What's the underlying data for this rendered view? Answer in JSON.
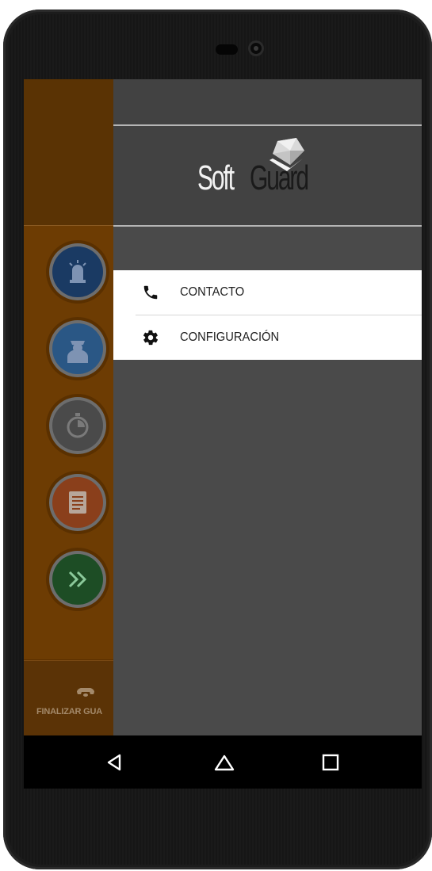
{
  "app": {
    "logo": {
      "part1": "Soft",
      "part2": "Guard"
    }
  },
  "drawer": {
    "menu": [
      {
        "label": "CONTACTO",
        "icon": "phone-icon"
      },
      {
        "label": "CONFIGURACIÓN",
        "icon": "gear-icon"
      }
    ]
  },
  "background": {
    "buttons": [
      {
        "icon": "siren-icon",
        "color": "#1a3a63"
      },
      {
        "icon": "guard-icon",
        "color": "#2a5785"
      },
      {
        "icon": "timer-icon",
        "color": "#4a4a4a"
      },
      {
        "icon": "document-icon",
        "color": "#8a3f1b"
      },
      {
        "icon": "forward-icon",
        "color": "#1d4d25"
      }
    ],
    "footer": {
      "label": "FINALIZAR GUA",
      "icon": "telephone-icon"
    }
  },
  "navbar": {
    "buttons": [
      "back-icon",
      "home-icon",
      "recents-icon"
    ]
  },
  "colors": {
    "drawer_bg": "#4a4a4a",
    "accent_orange": "#6d3c03",
    "menu_bg": "#ffffff"
  }
}
